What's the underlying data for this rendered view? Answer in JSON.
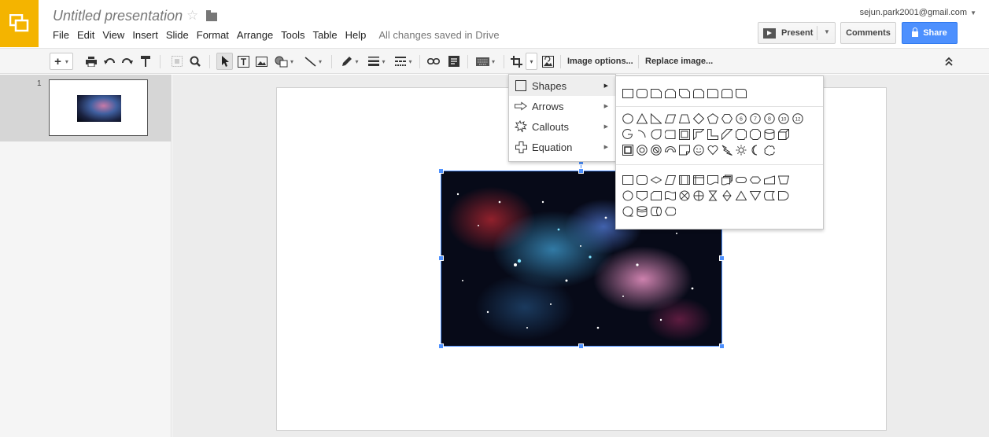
{
  "header": {
    "title": "Untitled presentation",
    "saved_status": "All changes saved in Drive",
    "account": "sejun.park2001@gmail.com"
  },
  "menus": [
    "File",
    "Edit",
    "View",
    "Insert",
    "Slide",
    "Format",
    "Arrange",
    "Tools",
    "Table",
    "Help"
  ],
  "buttons": {
    "present": "Present",
    "comments": "Comments",
    "share": "Share"
  },
  "toolbar": {
    "image_options": "Image options...",
    "replace_image": "Replace image..."
  },
  "filmstrip": {
    "slide_number": "1"
  },
  "shapes_menu": {
    "items": [
      {
        "label": "Shapes",
        "icon": "rectangle-icon"
      },
      {
        "label": "Arrows",
        "icon": "arrow-right-icon"
      },
      {
        "label": "Callouts",
        "icon": "callout-burst-icon"
      },
      {
        "label": "Equation",
        "icon": "plus-icon"
      }
    ]
  },
  "shape_palette": {
    "sections": [
      "rectangles",
      "basic-shapes",
      "flowchart"
    ],
    "count_labels": [
      "6",
      "7",
      "8",
      "10",
      "12"
    ]
  }
}
